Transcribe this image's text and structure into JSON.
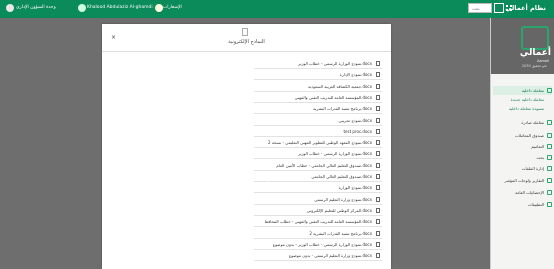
{
  "topbar": {
    "brand": "نظام أعمالي",
    "search_placeholder": "بحث",
    "notifications_label": "الإشعارات",
    "user_name": "Khalood Abdulaziz Al-ghamdi",
    "unit_label": "وحدة الشؤون الإداري"
  },
  "sidebar": {
    "logo_text": "أعمالي",
    "logo_latin": "Aamali",
    "logo_sub": "نحو تحقيق 2030",
    "items": [
      {
        "label": "معاملة داخلية",
        "active": true
      },
      {
        "label": "معاملة داخلية جديدة",
        "sub": true
      },
      {
        "label": "مسودة معاملة داخلية",
        "sub": true
      },
      {
        "label": "معاملة صادرة"
      },
      {
        "label": "صندوق المعاملات"
      },
      {
        "label": "التعاميم"
      },
      {
        "label": "بحث"
      },
      {
        "label": "إدارة الملفات"
      },
      {
        "label": "التقارير ولوحات المؤشر"
      },
      {
        "label": "الإحصائيات العامة"
      },
      {
        "label": "التطبيقات"
      }
    ]
  },
  "modal": {
    "title": "النماذج الإلكترونية",
    "close": "×",
    "files": [
      "نموذج الوزارة الرسمي - خطاب الوزير.docx",
      "نموذج الإدارة.docx",
      "جمعية الكشافة العربية السعودية.docx",
      "المؤسسة العامة للتدريب التقني والمهني.docx",
      "برنامج تنمية القدرات البشرية.docx",
      "نموذج تجريبي.docx",
      "test proc.docx",
      "نموذج المعهد الوطني للتطوير المهني التعليمي - نسخة 2.docx",
      "نموذج الوزارة الرسمي - خطاب الوزير.docx",
      "صندوق التعليم العالي الجامعي - خطاب الأمين العام.docx",
      "صندوق التعليم العالي الجامعي.docx",
      "نموذج الوزارة.docx",
      "نموذج وزارة التعليم الرسمي.docx",
      "المركز الوطني للتعليم الإلكتروني.docx",
      "المؤسسة العامة للتدريب التقني والمهني - خطاب المحافظ.docx",
      "برنامج تنمية القدرات البشرية 2.docx",
      "نموذج الوزارة الرسمي - خطاب الوزير - بدون موضوع.docx",
      "نموذج وزارة التعليم الرسمي - بدون موضوع.docx"
    ]
  }
}
